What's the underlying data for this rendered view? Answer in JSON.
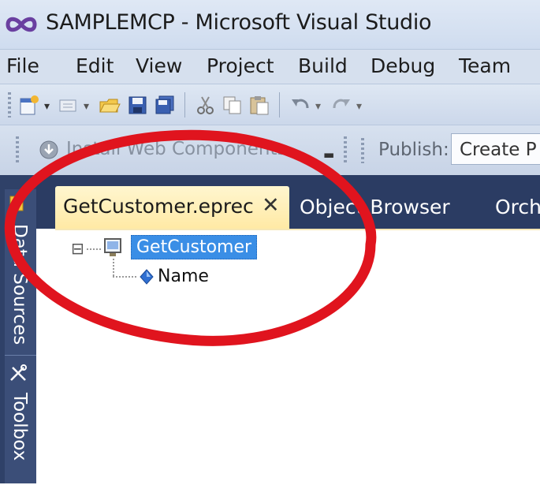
{
  "window": {
    "title": "SAMPLEMCP - Microsoft Visual Studio"
  },
  "menu": {
    "items": [
      "File",
      "Edit",
      "View",
      "Project",
      "Build",
      "Debug",
      "Team"
    ]
  },
  "toolbar": {
    "install_web_components": "Install Web Components",
    "publish_label": "Publish:",
    "publish_value": "Create P"
  },
  "dock": {
    "data_sources": "Data Sources",
    "toolbox": "Toolbox"
  },
  "tabs": {
    "active": "GetCustomer.eprec",
    "close_glyph": "✕",
    "object_browser": "Object Browser",
    "orch": "Orch"
  },
  "tree": {
    "root": "GetCustomer",
    "child": "Name",
    "expander_glyph": "⊟"
  },
  "colors": {
    "annotation": "#e0141e",
    "selection": "#3a8ee6",
    "active_tab": "#ffe9a3",
    "dock": "#2f4168"
  }
}
